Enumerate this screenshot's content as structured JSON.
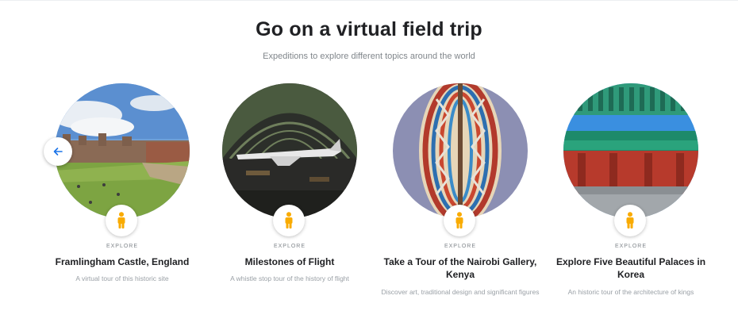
{
  "header": {
    "title": "Go on a virtual field trip",
    "subtitle": "Expeditions to explore different topics around the world"
  },
  "carousel": {
    "prev_icon": "arrow-back-icon",
    "cards": [
      {
        "eyebrow": "EXPLORE",
        "title": "Framlingham Castle, England",
        "description": "A virtual tour of this historic site",
        "icon": "pegman-icon"
      },
      {
        "eyebrow": "EXPLORE",
        "title": "Milestones of Flight",
        "description": "A whistle stop tour of the history of flight",
        "icon": "pegman-icon"
      },
      {
        "eyebrow": "EXPLORE",
        "title": "Take a Tour of the Nairobi Gallery, Kenya",
        "description": "Discover art, traditional design and significant figures",
        "icon": "pegman-icon"
      },
      {
        "eyebrow": "EXPLORE",
        "title": "Explore Five Beautiful Palaces in Korea",
        "description": "An historic tour of the architecture of kings",
        "icon": "pegman-icon"
      }
    ]
  },
  "colors": {
    "accent": "#1a73e8",
    "pegman": "#f9ab00",
    "text_primary": "#202124",
    "text_secondary": "#80868b"
  }
}
